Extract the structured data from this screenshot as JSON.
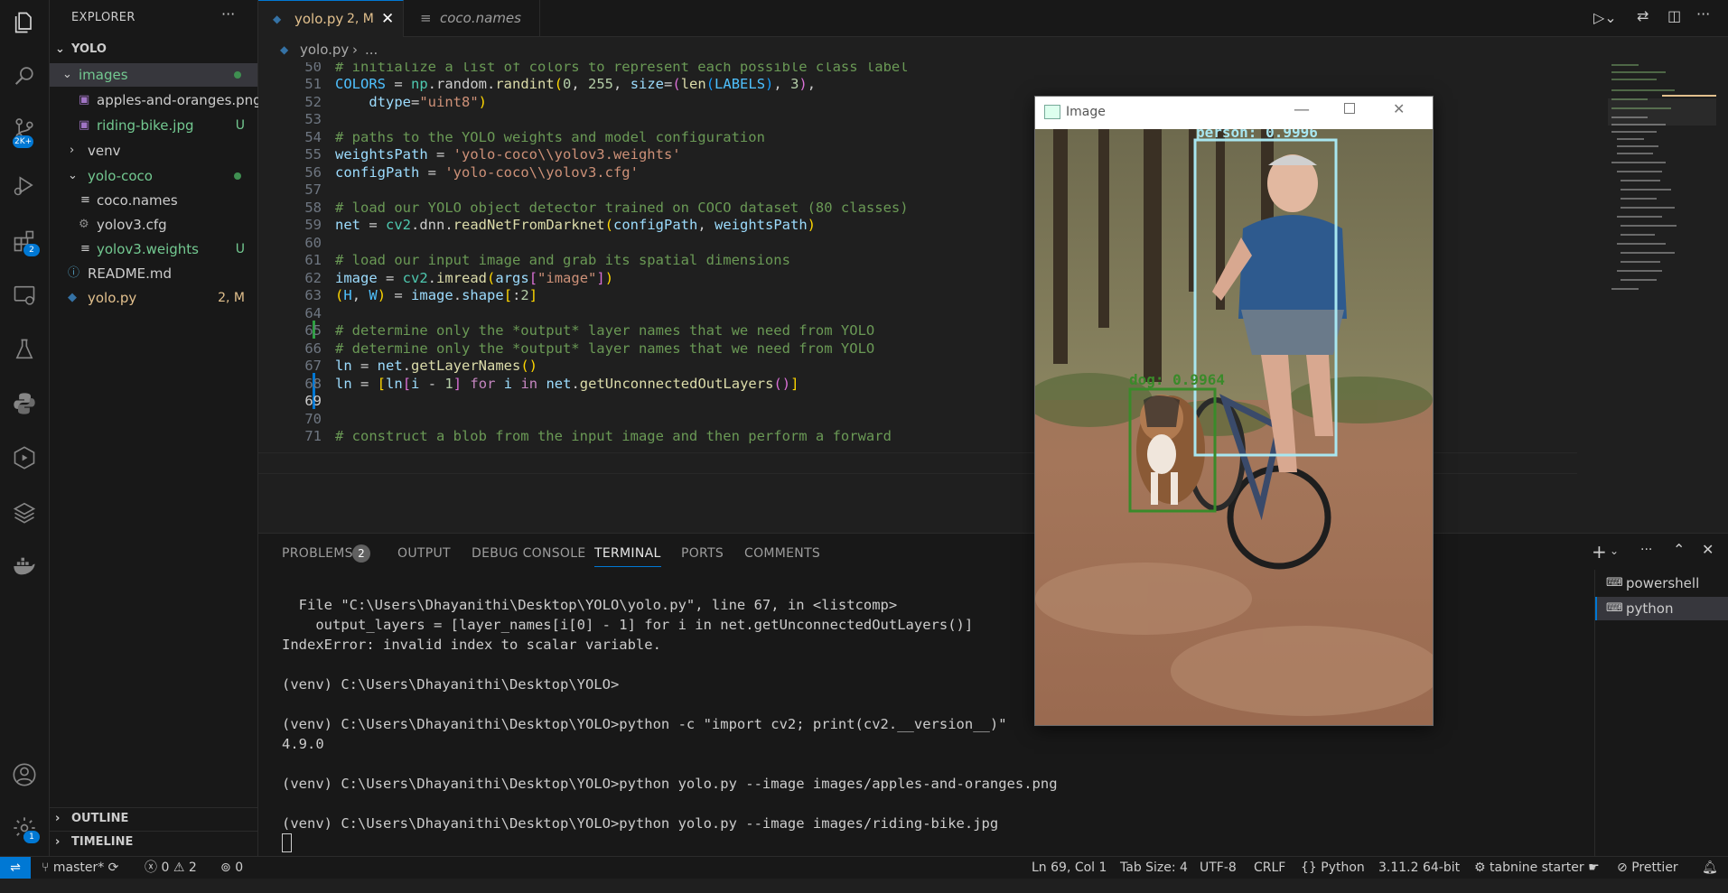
{
  "sidebar": {
    "title": "EXPLORER",
    "more": "···",
    "root": "YOLO",
    "items": [
      {
        "label": "images",
        "decoration": "",
        "kind": "folder-open"
      },
      {
        "label": "apples-and-oranges.png",
        "decoration": "",
        "kind": "image"
      },
      {
        "label": "riding-bike.jpg",
        "decoration": "U",
        "kind": "image"
      },
      {
        "label": "venv",
        "decoration": "",
        "kind": "folder-closed"
      },
      {
        "label": "yolo-coco",
        "decoration": "",
        "kind": "folder-open"
      },
      {
        "label": "coco.names",
        "decoration": "",
        "kind": "text"
      },
      {
        "label": "yolov3.cfg",
        "decoration": "",
        "kind": "gear"
      },
      {
        "label": "yolov3.weights",
        "decoration": "U",
        "kind": "text"
      },
      {
        "label": "README.md",
        "decoration": "",
        "kind": "info"
      },
      {
        "label": "yolo.py",
        "decoration": "2, M",
        "kind": "python"
      }
    ],
    "outline": "OUTLINE",
    "timeline": "TIMELINE"
  },
  "activity": {
    "scm_badge": "2K+",
    "extensions_badge": "2",
    "settings_badge": "1"
  },
  "tabs": [
    {
      "label": "yolo.py",
      "decoration": "2, M",
      "active": true
    },
    {
      "label": "coco.names",
      "decoration": "",
      "active": false
    }
  ],
  "breadcrumb": {
    "file": "yolo.py",
    "rest": "..."
  },
  "editor": {
    "lines": [
      {
        "n": "50",
        "text": "# initialize a list of colors to represent each possible class label"
      },
      {
        "n": "51",
        "text": "COLORS = np.random.randint(0, 255, size=(len(LABELS), 3),"
      },
      {
        "n": "52",
        "text": "    dtype=\"uint8\")"
      },
      {
        "n": "53",
        "text": ""
      },
      {
        "n": "54",
        "text": "# paths to the YOLO weights and model configuration"
      },
      {
        "n": "55",
        "text": "weightsPath = 'yolo-coco\\\\yolov3.weights'"
      },
      {
        "n": "56",
        "text": "configPath = 'yolo-coco\\\\yolov3.cfg'"
      },
      {
        "n": "57",
        "text": ""
      },
      {
        "n": "58",
        "text": "# load our YOLO object detector trained on COCO dataset (80 classes)"
      },
      {
        "n": "59",
        "text": "net = cv2.dnn.readNetFromDarknet(configPath, weightsPath)"
      },
      {
        "n": "60",
        "text": ""
      },
      {
        "n": "61",
        "text": "# load our input image and grab its spatial dimensions"
      },
      {
        "n": "62",
        "text": "image = cv2.imread(args[\"image\"])"
      },
      {
        "n": "63",
        "text": "(H, W) = image.shape[:2]"
      },
      {
        "n": "64",
        "text": ""
      },
      {
        "n": "65",
        "text": "# determine only the *output* layer names that we need from YOLO"
      },
      {
        "n": "66",
        "text": "# determine only the *output* layer names that we need from YOLO"
      },
      {
        "n": "67",
        "text": "ln = net.getLayerNames()"
      },
      {
        "n": "68",
        "text": "ln = [ln[i - 1] for i in net.getUnconnectedOutLayers()]"
      },
      {
        "n": "69",
        "text": ""
      },
      {
        "n": "70",
        "text": ""
      },
      {
        "n": "71",
        "text": "# construct a blob from the input image and then perform a forward"
      }
    ]
  },
  "panel": {
    "tabs": [
      "PROBLEMS",
      "OUTPUT",
      "DEBUG CONSOLE",
      "TERMINAL",
      "PORTS",
      "COMMENTS"
    ],
    "problems_count": "2",
    "active_tab": "TERMINAL",
    "terminal_lines": [
      "  File \"C:\\Users\\Dhayanithi\\Desktop\\YOLO\\yolo.py\", line 67, in <listcomp>",
      "    output_layers = [layer_names[i[0] - 1] for i in net.getUnconnectedOutLayers()]",
      "IndexError: invalid index to scalar variable.",
      "",
      "(venv) C:\\Users\\Dhayanithi\\Desktop\\YOLO>",
      "",
      "(venv) C:\\Users\\Dhayanithi\\Desktop\\YOLO>python -c \"import cv2; print(cv2.__version__)\"",
      "4.9.0",
      "",
      "(venv) C:\\Users\\Dhayanithi\\Desktop\\YOLO>python yolo.py --image images/apples-and-oranges.png",
      "",
      "(venv) C:\\Users\\Dhayanithi\\Desktop\\YOLO>python yolo.py --image images/riding-bike.jpg"
    ],
    "terminals": [
      "powershell",
      "python"
    ]
  },
  "image_window": {
    "title": "Image",
    "detections": [
      {
        "label": "person: 0.9996",
        "color": "#a8e6f0"
      },
      {
        "label": "dog: 0.9964",
        "color": "#3a8a2a"
      }
    ]
  },
  "status": {
    "branch": "master*",
    "errors": "0",
    "warnings": "2",
    "ports": "0",
    "position": "Ln 69, Col 1",
    "tab_size": "Tab Size: 4",
    "encoding": "UTF-8",
    "eol": "CRLF",
    "language": "Python",
    "interpreter": "3.11.2 64-bit",
    "tabnine": "tabnine starter",
    "prettier": "Prettier"
  },
  "colors": {
    "accent": "#0078d4",
    "modified": "#e2c08d",
    "untracked": "#73c991"
  }
}
